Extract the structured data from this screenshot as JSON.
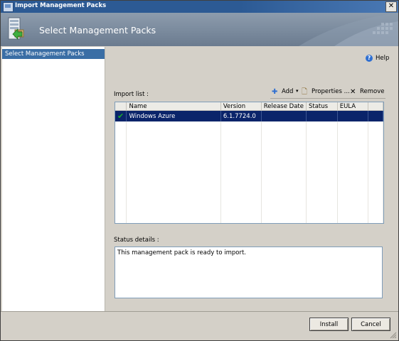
{
  "window": {
    "title": "Import Management Packs",
    "close_label": "✕"
  },
  "banner": {
    "title": "Select Management Packs"
  },
  "sidebar": {
    "items": [
      {
        "label": "Select Management Packs",
        "selected": true
      }
    ]
  },
  "help": {
    "label": "Help",
    "icon": "help-icon"
  },
  "import_list": {
    "label": "Import list :",
    "toolbar": {
      "add_label": "Add",
      "properties_label": "Properties ...",
      "remove_label": "Remove"
    },
    "columns": [
      "",
      "Name",
      "Version",
      "Release Date",
      "Status",
      "EULA",
      ""
    ],
    "rows": [
      {
        "checked": true,
        "name": "Windows Azure",
        "version": "6.1.7724.0",
        "release_date": "",
        "status": "",
        "eula": ""
      }
    ]
  },
  "status": {
    "label": "Status details :",
    "text": "This management pack is ready to import."
  },
  "buttons": {
    "install": "Install",
    "cancel": "Cancel"
  },
  "colors": {
    "title_bar": "#2c5a94",
    "selection": "#0a246a",
    "sidebar_selected": "#3a6ea5",
    "banner": "#7a8a9d"
  }
}
